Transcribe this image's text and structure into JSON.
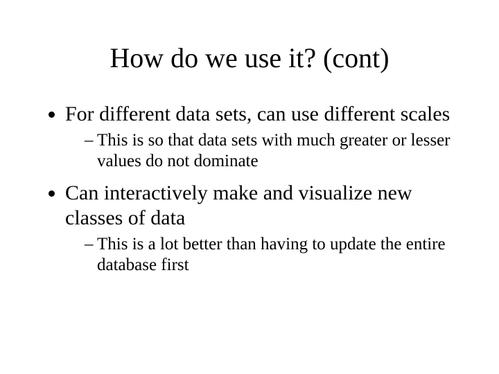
{
  "title": "How do we use it? (cont)",
  "bullets": [
    {
      "text": "For different data sets, can use different scales",
      "sub": [
        "This is so that data sets with much greater or lesser values do not dominate"
      ]
    },
    {
      "text": "Can interactively make and visualize new classes of data",
      "sub": [
        "This is a lot better than having to update the entire database first"
      ]
    }
  ]
}
